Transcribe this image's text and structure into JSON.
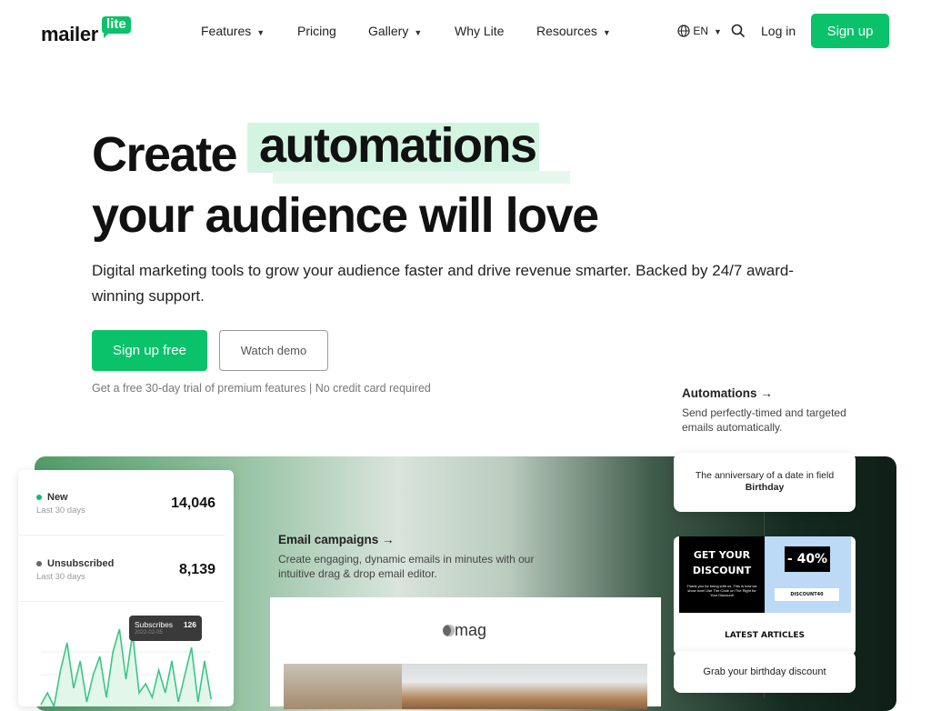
{
  "header": {
    "logo_text": "mailer",
    "logo_badge": "lite",
    "nav": [
      {
        "label": "Features",
        "dropdown": true
      },
      {
        "label": "Pricing"
      },
      {
        "label": "Gallery",
        "dropdown": true
      },
      {
        "label": "Why Lite"
      },
      {
        "label": "Resources",
        "dropdown": true
      }
    ],
    "language": "EN",
    "login": "Log in",
    "signup": "Sign up"
  },
  "hero": {
    "title_pre": "Create",
    "title_highlight": "automations",
    "title_line2": "your audience will love",
    "subtitle": "Digital marketing tools to grow your audience faster and drive revenue smarter. Backed by 24/7 award-winning support.",
    "cta_primary": "Sign up free",
    "cta_secondary": "Watch demo",
    "note": "Get a free 30-day trial of premium features | No credit card required"
  },
  "stats": {
    "items": [
      {
        "label": "New",
        "sub": "Last 30 days",
        "value": "14,046",
        "color": "#09c269"
      },
      {
        "label": "Unsubscribed",
        "sub": "Last 30 days",
        "value": "8,139",
        "color": "#666666"
      }
    ],
    "tooltip": {
      "label": "Subscribes",
      "value": "126",
      "date": "2022-02-05"
    }
  },
  "email_campaigns": {
    "title": "Email campaigns →",
    "desc": "Create engaging, dynamic emails in minutes with our intuitive drag & drop email editor.",
    "preview_brand": "mag"
  },
  "automations": {
    "title": "Automations →",
    "desc": "Send perfectly-timed and targeted emails automatically.",
    "trigger_text": "The anniversary of a date in field",
    "trigger_field": "Birthday",
    "email_heading": "GET YOUR DISCOUNT",
    "email_body": "Thank you for being with us. This is how we show love! Use The Code on The Right for Your Discount!",
    "discount": "- 40%",
    "code": "DISCOUNT40",
    "articles": "LATEST ARTICLES",
    "action": "Grab your birthday discount"
  },
  "colors": {
    "brand": "#09c269",
    "highlight": "#d4f4e2"
  }
}
